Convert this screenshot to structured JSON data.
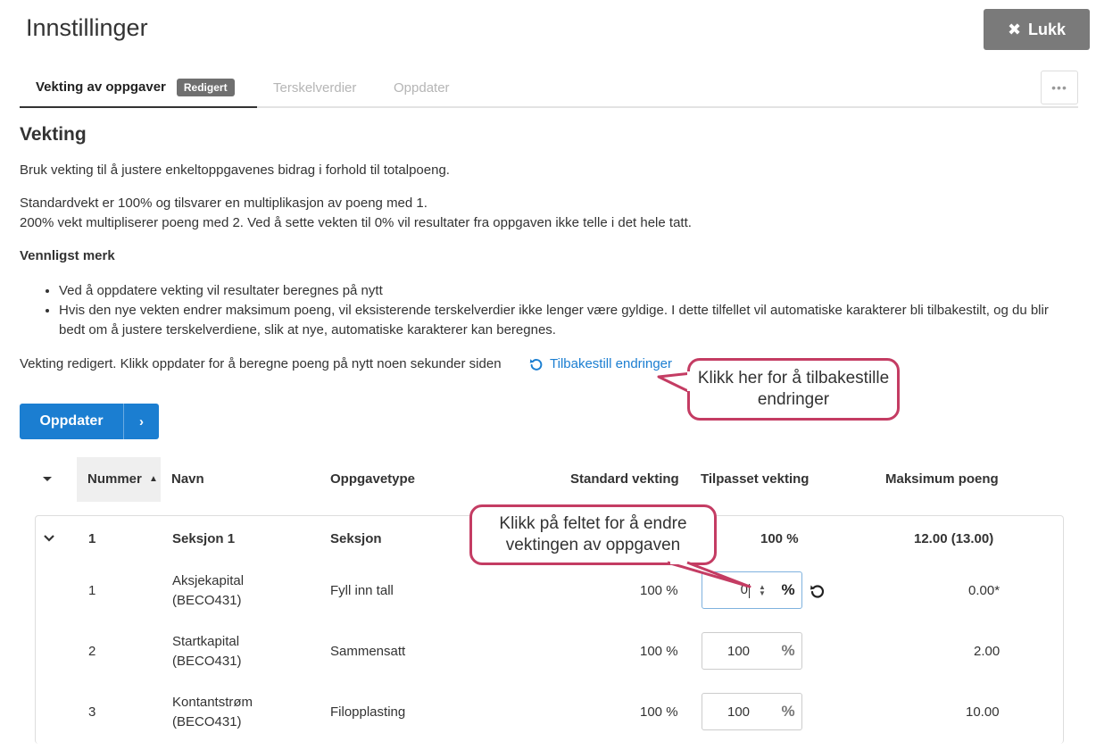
{
  "header": {
    "title": "Innstillinger",
    "close_label": "Lukk"
  },
  "tabs": [
    {
      "label": "Vekting av oppgaver",
      "badge": "Redigert"
    },
    {
      "label": "Terskelverdier"
    },
    {
      "label": "Oppdater"
    }
  ],
  "more_label": "•••",
  "content": {
    "heading": "Vekting",
    "intro": "Bruk vekting til å justere enkeltoppgavenes bidrag i forhold til totalpoeng.",
    "standard_line1": "Standardvekt er 100% og tilsvarer en multiplikasjon av poeng med 1.",
    "standard_line2": "200% vekt multipliserer poeng med 2. Ved å sette vekten til 0% vil resultater fra oppgaven ikke telle i det hele tatt.",
    "note_heading": "Vennligst merk",
    "bullets": [
      "Ved å oppdatere vekting vil resultater beregnes på nytt",
      "Hvis den nye vekten endrer maksimum poeng, vil eksisterende terskelverdier ikke lenger være gyldige. I dette tilfellet vil automatiske karakterer bli tilbakestilt, og du blir bedt om å justere terskelverdiene, slik at nye, automatiske karakterer kan beregnes."
    ],
    "status": "Vekting redigert. Klikk oppdater for å beregne poeng på nytt noen sekunder siden",
    "reset_link": "Tilbakestill endringer",
    "update_button": "Oppdater"
  },
  "callouts": {
    "reset": "Klikk her for å tilbakestille endringer",
    "field": "Klikk på feltet for å endre vektingen av oppgaven"
  },
  "table": {
    "headers": {
      "number": "Nummer",
      "name": "Navn",
      "type": "Oppgavetype",
      "standard": "Standard vekting",
      "custom": "Tilpasset vekting",
      "max": "Maksimum poeng"
    },
    "section": {
      "number": "1",
      "name": "Seksjon 1",
      "type": "Seksjon",
      "custom": "100 %",
      "max": "12.00 (13.00)"
    },
    "rows": [
      {
        "number": "1",
        "name_line1": "Aksjekapital",
        "name_line2": "(BECO431)",
        "type": "Fyll inn tall",
        "standard": "100 %",
        "custom": "0",
        "pct": "%",
        "max": "0.00*"
      },
      {
        "number": "2",
        "name_line1": "Startkapital",
        "name_line2": "(BECO431)",
        "type": "Sammensatt",
        "standard": "100 %",
        "custom": "100",
        "pct": "%",
        "max": "2.00"
      },
      {
        "number": "3",
        "name_line1": "Kontantstrøm",
        "name_line2": "(BECO431)",
        "type": "Filopplasting",
        "standard": "100 %",
        "custom": "100",
        "pct": "%",
        "max": "10.00"
      }
    ]
  },
  "colors": {
    "primary": "#1b7ed1",
    "callout_border": "#c43c63",
    "close_button": "#7a7a7a"
  }
}
